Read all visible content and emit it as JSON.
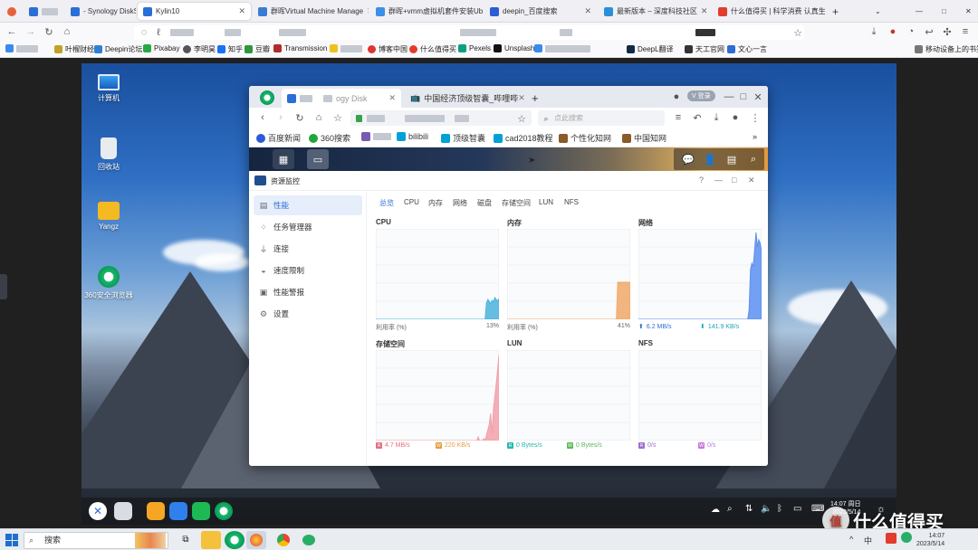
{
  "host_tabs": [
    {
      "label": "- Synology DiskSt",
      "fav": "#2a6fd6"
    },
    {
      "label": "Kylin10",
      "fav": "#2a6fd6"
    },
    {
      "label": "群晖Virtual Machine Manage",
      "fav": "#3b7bd6"
    },
    {
      "label": "群晖+vmm虚拟机套件安装Ub",
      "fav": "#3b8fe6"
    },
    {
      "label": "deepin_百度搜索",
      "fav": "#2d5bd6"
    },
    {
      "label": "最新版本 – 深度科技社区",
      "fav": "#2a8fd6"
    },
    {
      "label": "什么值得买 | 科学消费 认真生活",
      "fav": "#e23c2e"
    }
  ],
  "host_new_tab": "+",
  "host_bookmarks": [
    {
      "label": "叶榴财经",
      "color": "#c2a12a"
    },
    {
      "label": "Deepin论坛",
      "color": "#2f7fd6"
    },
    {
      "label": "Pixabay",
      "color": "#29a744"
    },
    {
      "label": "李明昊",
      "color": "#555555"
    },
    {
      "label": "知乎",
      "color": "#1772f6"
    },
    {
      "label": "豆瓣",
      "color": "#2e963d"
    },
    {
      "label": "Transmission",
      "color": "#b22b2b"
    },
    {
      "label": "博客中国",
      "color": "#d33"
    },
    {
      "label": "什么值得买",
      "color": "#e23c2e"
    },
    {
      "label": "Pexels",
      "color": "#07a081"
    },
    {
      "label": "Unsplash",
      "color": "#111111"
    },
    {
      "label": "DeepL翻译",
      "color": "#0f2b46"
    },
    {
      "label": "天工官网",
      "color": "#333333"
    },
    {
      "label": "文心一言",
      "color": "#2f6bd6"
    },
    {
      "label": "移动设备上的书签",
      "color": "#777777"
    }
  ],
  "desktop_icons": [
    {
      "label": "计算机"
    },
    {
      "label": "回收站"
    },
    {
      "label": "Yangz"
    },
    {
      "label": "360安全浏览器"
    }
  ],
  "browser": {
    "tabs": [
      {
        "label": "ogy Disk"
      },
      {
        "label": "中国经济顶级智囊_哔哩哔"
      }
    ],
    "new_tab": "+",
    "vip_badge": "V 登录",
    "search_placeholder": "点此搜索",
    "bookmarks": [
      {
        "label": "百度新闻",
        "color": "#2d5bd6"
      },
      {
        "label": "360搜索",
        "color": "#22a63a"
      },
      {
        "label": "bilibili",
        "color": "#00a1d6"
      },
      {
        "label": "顶级智囊",
        "color": "#00a1d6"
      },
      {
        "label": "cad2018教程",
        "color": "#00a1d6"
      },
      {
        "label": "个性化知网",
        "color": "#8a5a2b"
      },
      {
        "label": "中国知网",
        "color": "#8a5a2b"
      }
    ],
    "more_bookmarks": "»"
  },
  "resource_monitor": {
    "title": "资源监控",
    "window_controls": {
      "help": "?",
      "minimize": "—",
      "maximize": "□",
      "close": "✕"
    },
    "sidebar": [
      {
        "label": "性能",
        "icon": "chart-icon",
        "active": true
      },
      {
        "label": "任务管理器",
        "icon": "tasks-icon",
        "active": false
      },
      {
        "label": "连接",
        "icon": "plug-icon",
        "active": false
      },
      {
        "label": "速度限制",
        "icon": "speed-icon",
        "active": false
      },
      {
        "label": "性能警报",
        "icon": "alert-icon",
        "active": false
      },
      {
        "label": "设置",
        "icon": "gear-icon",
        "active": false
      }
    ],
    "tabs": [
      "总览",
      "CPU",
      "内存",
      "网络",
      "磁盘",
      "存储空间",
      "LUN",
      "NFS"
    ],
    "panels": {
      "cpu": {
        "title": "CPU",
        "label": "利用率 (%)",
        "value": "13%",
        "usage_series": [
          0,
          0,
          0,
          0,
          0,
          0,
          0,
          0,
          0,
          0,
          0,
          0,
          0,
          0,
          0,
          0,
          0,
          0,
          0,
          0,
          0,
          0,
          0,
          0,
          0,
          0,
          0,
          0,
          0,
          0,
          0,
          0,
          0,
          0,
          0,
          0,
          0,
          0,
          0,
          0,
          0,
          0,
          0,
          0,
          0,
          0,
          0,
          0,
          0,
          0,
          0,
          0,
          0,
          0,
          0,
          0,
          0,
          0,
          0,
          0,
          0,
          0,
          0,
          0,
          0,
          0,
          0,
          0,
          0,
          0,
          0,
          0,
          0,
          0,
          0,
          0,
          0,
          0,
          0,
          0,
          18,
          22,
          20,
          17,
          21,
          19,
          24,
          22,
          20,
          23
        ],
        "color": "#4ab3dd"
      },
      "memory": {
        "title": "内存",
        "label": "利用率 (%)",
        "value": "41%",
        "usage_series": [
          0,
          0,
          0,
          0,
          0,
          0,
          0,
          0,
          0,
          0,
          0,
          0,
          0,
          0,
          0,
          0,
          0,
          0,
          0,
          0,
          0,
          0,
          0,
          0,
          0,
          0,
          0,
          0,
          0,
          0,
          0,
          0,
          0,
          0,
          0,
          0,
          0,
          0,
          0,
          0,
          0,
          0,
          0,
          0,
          0,
          0,
          0,
          0,
          0,
          0,
          0,
          0,
          0,
          0,
          0,
          0,
          0,
          0,
          0,
          0,
          0,
          0,
          0,
          0,
          0,
          0,
          0,
          0,
          0,
          0,
          0,
          0,
          0,
          0,
          0,
          0,
          0,
          0,
          0,
          0,
          41,
          41,
          41,
          41,
          41,
          41,
          41,
          41,
          41,
          41
        ],
        "color": "#f0a868"
      },
      "network": {
        "title": "网络",
        "up_label": "6.2 MB/s",
        "down_label": "141.9 KB/s",
        "series": [
          0,
          0,
          0,
          0,
          0,
          0,
          0,
          0,
          0,
          0,
          0,
          0,
          0,
          0,
          0,
          0,
          0,
          0,
          0,
          0,
          0,
          0,
          0,
          0,
          0,
          0,
          0,
          0,
          0,
          0,
          0,
          0,
          0,
          0,
          0,
          0,
          0,
          0,
          0,
          0,
          0,
          0,
          0,
          0,
          0,
          0,
          0,
          0,
          0,
          0,
          0,
          0,
          0,
          0,
          0,
          0,
          0,
          0,
          0,
          0,
          0,
          0,
          0,
          0,
          0,
          0,
          0,
          0,
          0,
          0,
          0,
          0,
          0,
          0,
          0,
          0,
          0,
          0,
          0,
          0,
          10,
          55,
          62,
          58,
          78,
          96,
          80,
          88,
          84,
          74
        ],
        "color": "#5a8ff0"
      },
      "storage": {
        "title": "存储空间",
        "read_label": "4.7 MB/s",
        "write_label": "220 KB/s",
        "series": [
          0,
          0,
          0,
          0,
          0,
          0,
          0,
          0,
          0,
          0,
          0,
          0,
          0,
          0,
          0,
          0,
          0,
          0,
          0,
          0,
          0,
          0,
          0,
          0,
          0,
          0,
          0,
          0,
          0,
          0,
          0,
          0,
          0,
          0,
          0,
          0,
          0,
          0,
          0,
          0,
          0,
          0,
          0,
          0,
          0,
          0,
          0,
          0,
          0,
          0,
          0,
          0,
          0,
          0,
          0,
          0,
          0,
          0,
          0,
          0,
          0,
          0,
          0,
          0,
          0,
          0,
          0,
          0,
          0,
          0,
          0,
          0,
          0,
          0,
          4,
          0,
          0,
          0,
          2,
          0,
          6,
          12,
          18,
          30,
          8,
          35,
          48,
          62,
          78,
          95
        ],
        "color": "#f2a0a8"
      },
      "lun": {
        "title": "LUN",
        "read_label": "0 Bytes/s",
        "write_label": "0 Bytes/s"
      },
      "nfs": {
        "title": "NFS",
        "read_label": "0/s",
        "write_label": "0/s"
      }
    }
  },
  "dsm_header": {
    "apps_icon": "grid-icon",
    "monitor_icon": "monitor-icon"
  },
  "kylin_tray": {
    "time": "14:07 周日",
    "date": "2023/5/14"
  },
  "windows_taskbar": {
    "search_placeholder": "搜索",
    "time": "14:07",
    "date": "2023/5/14"
  },
  "watermark": {
    "text": "什么值得买",
    "badge": "值"
  },
  "colors": {
    "accent": "#2a6fd6",
    "dsm_header_end": "#e29a3d"
  }
}
